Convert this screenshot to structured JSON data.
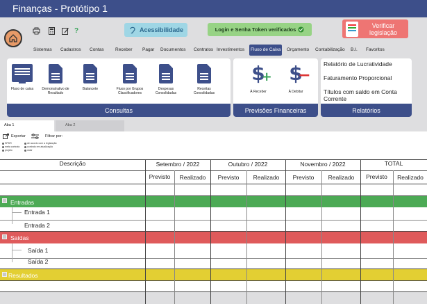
{
  "app": {
    "title": "Finanças - Protótipo 1"
  },
  "toolbar": {
    "accessibility_label": "Acessibilidade",
    "login_label": "Login e Senha Token verificados",
    "verify_label": "Verificar legislação",
    "icons": [
      "print-icon",
      "calculator-icon",
      "edit-icon",
      "help-icon"
    ]
  },
  "menu": {
    "items": [
      "Sistemas",
      "Cadastros",
      "Contas",
      "Receber",
      "Pagar",
      "Documentos",
      "Contratos",
      "Investimentos",
      "Fluxo de Caixa",
      "Orçamento",
      "Contabilização",
      "B.I.",
      "Favoritos"
    ],
    "active": "Fluxo de Caixa"
  },
  "consultas": {
    "title": "Consultas",
    "buttons": [
      {
        "label": "Fluxo de caixa",
        "icon": "monitor-icon"
      },
      {
        "label": "Demonstrativo de Resultado",
        "icon": "document-icon"
      },
      {
        "label": "Balancete",
        "icon": "document-icon"
      },
      {
        "label": "Fluxo por Grupos Classificadores",
        "icon": "document-icon"
      },
      {
        "label": "Despesas Consolidadas",
        "icon": "document-icon"
      },
      {
        "label": "Receitas Consolidadas",
        "icon": "document-icon"
      }
    ]
  },
  "previsoes": {
    "title": "Previsões Financeiras",
    "buttons": [
      {
        "label": "À Receber",
        "icon": "dollar-plus-icon"
      },
      {
        "label": "À Debitar",
        "icon": "dollar-minus-icon"
      }
    ]
  },
  "relatorios": {
    "title": "Relatórios",
    "items": [
      "Relatório de Lucratividade",
      "Faturamento Proporcional",
      "Títulos com saldo em Conta Corrente"
    ]
  },
  "tabs": [
    "Aba 1",
    "Aba 2"
  ],
  "actions": {
    "export_label": "Exportar",
    "filter_label": "Filtrar por:",
    "legend": [
      "SPDR",
      "de acordo com a legislação",
      "meta contrato",
      "contrato em atualização",
      "projeto",
      "valor"
    ]
  },
  "table": {
    "desc_header": "Descrição",
    "months": [
      "Setembro / 2022",
      "Outubro / 2022",
      "Novembro / 2022",
      "TOTAL"
    ],
    "sub_headers": [
      "Previsto",
      "Realizado",
      "Previsto",
      "Realizado",
      "Previsto",
      "Realizado",
      "Previsto",
      "Realizado"
    ],
    "sections": [
      {
        "label": "Entradas",
        "color": "#4caa55",
        "children": [
          "Entrada 1",
          "Entrada 2"
        ]
      },
      {
        "label": "Saídas",
        "color": "#df5a5b",
        "children": [
          "Saída 1",
          "Saída 2"
        ]
      },
      {
        "label": "Resultados",
        "color": "#e3cf33",
        "children": []
      }
    ]
  }
}
